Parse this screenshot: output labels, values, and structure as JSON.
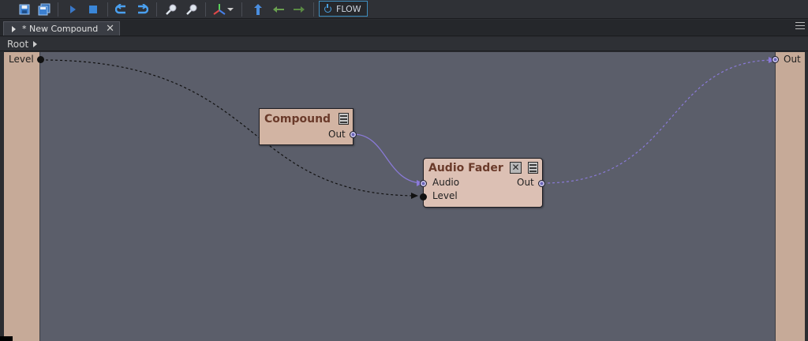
{
  "toolbar": {
    "buttons": [
      "save-icon",
      "save-all-icon",
      "play-icon",
      "stop-icon",
      "undo-icon",
      "redo-icon",
      "zoom-in-icon",
      "zoom-out-icon",
      "axis-icon",
      "up-icon",
      "back-icon",
      "forward-icon"
    ],
    "flow_label": "FLOW"
  },
  "tab": {
    "title": "* New Compound",
    "close": "✕"
  },
  "breadcrumb": {
    "root": "Root"
  },
  "rails": {
    "left_label": "Level",
    "right_label": "Out",
    "color": "#c6aa98"
  },
  "nodes": {
    "compound": {
      "title": "Compound",
      "out_label": "Out"
    },
    "fader": {
      "title": "Audio Fader",
      "audio_label": "Audio",
      "level_label": "Level",
      "out_label": "Out"
    }
  },
  "colors": {
    "canvas": "#5b5e6a",
    "audio_wire": "#8a7ad8",
    "control_wire": "#111111",
    "node_title": "#6a3a2a",
    "flow_border": "#3f8fc0"
  }
}
